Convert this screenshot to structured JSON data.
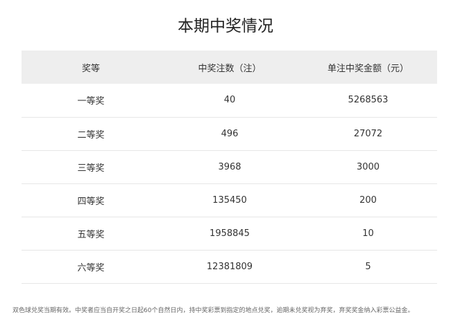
{
  "page": {
    "title": "本期中奖情况"
  },
  "table": {
    "headers": [
      "奖等",
      "中奖注数（注）",
      "单注中奖金额（元）"
    ],
    "rows": [
      {
        "level": "一等奖",
        "count": "40",
        "amount": "5268563"
      },
      {
        "level": "二等奖",
        "count": "496",
        "amount": "27072"
      },
      {
        "level": "三等奖",
        "count": "3968",
        "amount": "3000"
      },
      {
        "level": "四等奖",
        "count": "135450",
        "amount": "200"
      },
      {
        "level": "五等奖",
        "count": "1958845",
        "amount": "10"
      },
      {
        "level": "六等奖",
        "count": "12381809",
        "amount": "5"
      }
    ]
  },
  "footnote": {
    "text": "双色球兑奖当期有效。中奖者应当自开奖之日起60个自然日内，持中奖彩票到指定的地点兑奖，逾期未兑奖视为弃奖，弃奖奖金纳入彩票公益金。"
  },
  "colors": {
    "header_bg": "#eeeeee",
    "row_border": "#e6e6e6",
    "text": "#333333"
  }
}
